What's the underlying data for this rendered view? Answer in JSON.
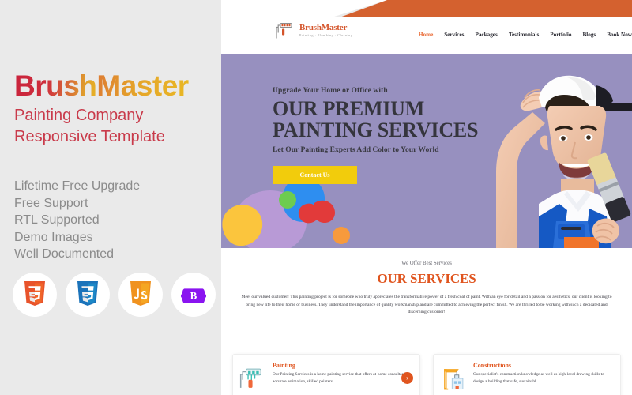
{
  "promo": {
    "title_part1": "Brush",
    "title_part2": "Master",
    "subtitle_line1": "Painting Company",
    "subtitle_line2": "Responsive Template",
    "features": [
      "Lifetime Free Upgrade",
      "Free Support",
      "RTL Supported",
      "Demo Images",
      "Well Documented"
    ],
    "tech_badges": [
      {
        "name": "html5-icon",
        "label": "5"
      },
      {
        "name": "css3-icon",
        "label": "3"
      },
      {
        "name": "javascript-icon",
        "label": "JS"
      },
      {
        "name": "bootstrap-icon",
        "label": "B"
      }
    ]
  },
  "site": {
    "logo": {
      "name": "BrushMaster",
      "tagline": "Painting · Plumbing · Cleaning"
    },
    "nav": [
      {
        "label": "Home",
        "active": true
      },
      {
        "label": "Services",
        "active": false
      },
      {
        "label": "Packages",
        "active": false
      },
      {
        "label": "Testimonials",
        "active": false
      },
      {
        "label": "Portfolio",
        "active": false
      },
      {
        "label": "Blogs",
        "active": false
      },
      {
        "label": "Book Now",
        "active": false
      }
    ],
    "hero": {
      "kicker": "Upgrade Your Home or Office with",
      "heading_line1": "OUR PREMIUM",
      "heading_line2": "PAINTING SERVICES",
      "subheading": "Let Our Painting Experts Add Color to Your World",
      "cta_label": "Contact Us"
    },
    "services": {
      "kicker": "We Offer Best Services",
      "title": "OUR SERVICES",
      "paragraph": "Meet our valued customer! This painting project is for someone who truly appreciates the transformative power of a fresh coat of paint. With an eye for detail and a passion for aesthetics, our client is looking to bring new life to their home or business. They understand the importance of quality workmanship and are committed to achieving the perfect finish. We are thrilled to be working with such a dedicated and discerning customer!",
      "cards": [
        {
          "icon": "paint-roller-icon",
          "title": "Painting",
          "text": "Our Painting Services is a home painting service that offers at-home consultancy, accurate estimation, skilled painters"
        },
        {
          "icon": "crane-icon",
          "title": "Constructions",
          "text": "Our specialist's construction knowledge as well as high-level drawing skills to design a building that safe, sustainabl"
        }
      ]
    }
  },
  "colors": {
    "promo_bg": "#eaeaea",
    "accent_orange": "#d4542a",
    "ribbon_orange": "#d4612f",
    "hero_purple": "#9790bf",
    "cta_yellow": "#f2cc0c",
    "title_red": "#c93b4b",
    "services_orange": "#e0551f"
  }
}
